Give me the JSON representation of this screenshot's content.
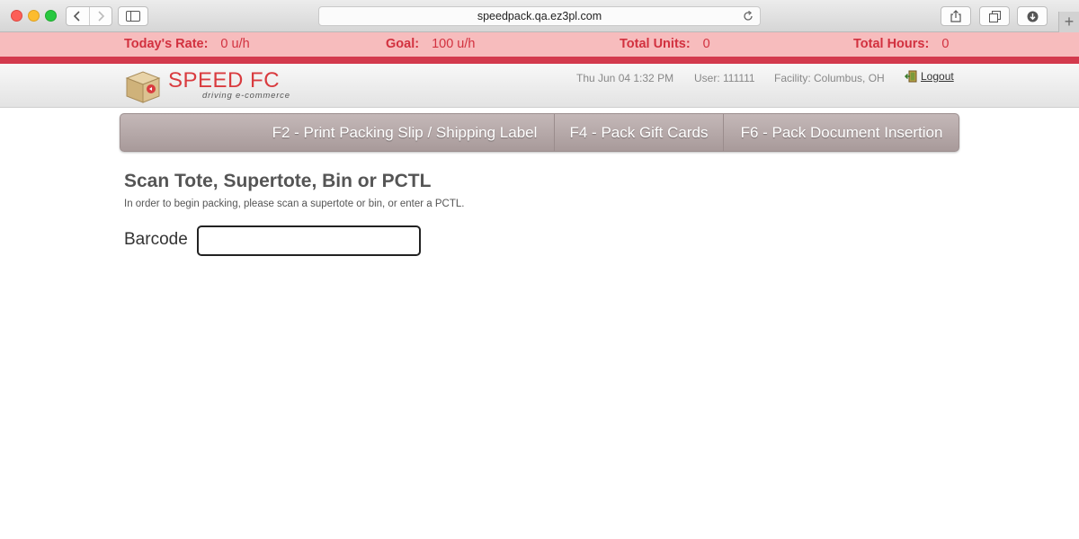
{
  "browser": {
    "url": "speedpack.qa.ez3pl.com",
    "newtab_symbol": "+"
  },
  "stats": {
    "rate_label": "Today's Rate:",
    "rate_value": "0  u/h",
    "goal_label": "Goal:",
    "goal_value": "100  u/h",
    "units_label": "Total Units:",
    "units_value": "0",
    "hours_label": "Total Hours:",
    "hours_value": "0"
  },
  "header": {
    "logo_title": "SPEED FC",
    "logo_tagline": "driving e-commerce",
    "datetime": "Thu Jun 04 1:32 PM",
    "user": "User: 111111",
    "facility": "Facility: Columbus, OH",
    "logout_label": "Logout"
  },
  "menu": {
    "items": [
      {
        "label": "F2 - Print Packing Slip / Shipping Label"
      },
      {
        "label": "F4 - Pack Gift Cards"
      },
      {
        "label": "F6 - Pack Document Insertion"
      }
    ]
  },
  "main": {
    "title": "Scan Tote, Supertote, Bin or PCTL",
    "description": "In order to begin packing, please scan a supertote or bin, or enter a PCTL.",
    "barcode_label": "Barcode",
    "barcode_value": ""
  },
  "colors": {
    "stats_bg": "#f7bcbd",
    "stats_text": "#d2313f",
    "accent_band": "#d33a4d",
    "logo_red": "#d93b3f",
    "menu_bg": "#b3a5a5"
  },
  "icons": {
    "back": "chevron-left-icon",
    "forward": "chevron-right-icon",
    "sidebar": "sidebar-icon",
    "reload": "reload-icon",
    "share": "share-icon",
    "tabs": "tabs-icon",
    "download": "download-icon",
    "logo": "package-box-icon",
    "logout": "exit-door-icon"
  }
}
